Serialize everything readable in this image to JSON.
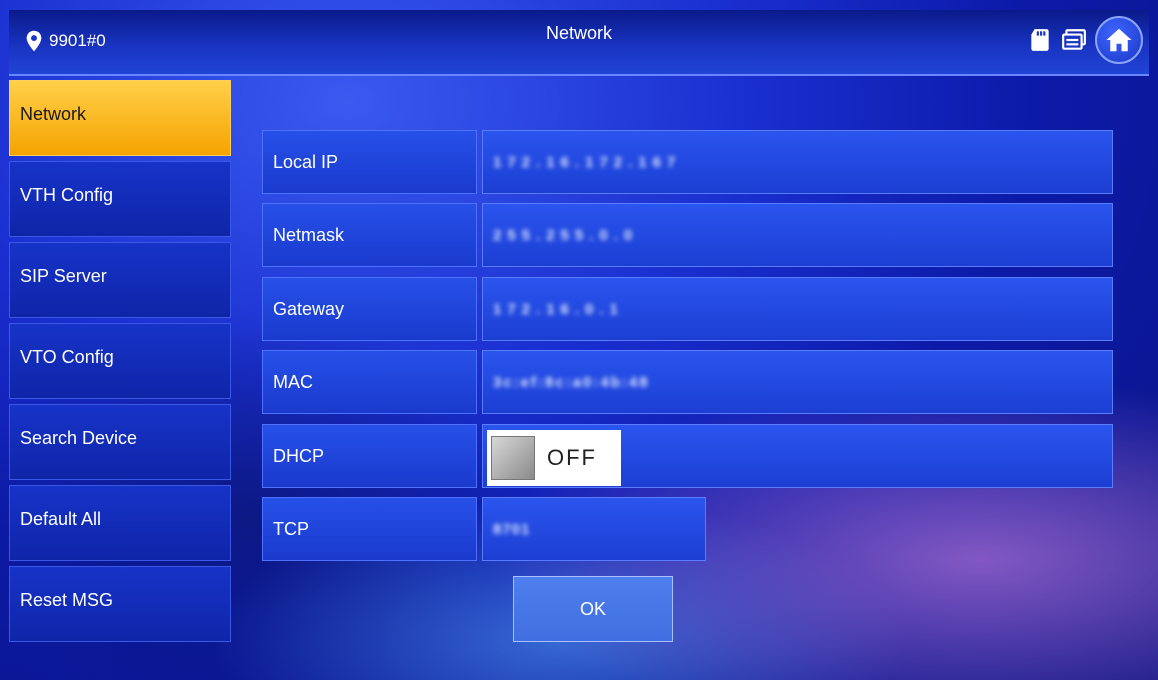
{
  "header": {
    "location": "9901#0",
    "title": "Network"
  },
  "icons": {
    "location": "location-pin-icon",
    "sd_card": "sd-card-icon",
    "message": "message-icon",
    "home": "home-icon"
  },
  "sidebar": {
    "items": [
      {
        "label": "Network",
        "active": true
      },
      {
        "label": "VTH Config"
      },
      {
        "label": "SIP Server"
      },
      {
        "label": "VTO Config"
      },
      {
        "label": "Search Device"
      },
      {
        "label": "Default All"
      },
      {
        "label": "Reset MSG"
      }
    ]
  },
  "form": {
    "local_ip": {
      "label": "Local IP",
      "value": "172.16.172.167"
    },
    "netmask": {
      "label": "Netmask",
      "value": "255.255.0.0"
    },
    "gateway": {
      "label": "Gateway",
      "value": "172.16.0.1"
    },
    "mac": {
      "label": "MAC",
      "value": "3c:ef:8c:a0:4b:48"
    },
    "dhcp": {
      "label": "DHCP",
      "state": "OFF"
    },
    "tcp": {
      "label": "TCP",
      "value": "8701"
    }
  },
  "ok_label": "OK",
  "colors": {
    "active_tab": "#f5b21a",
    "panel": "#1e40d8",
    "background": "#1528c0"
  }
}
